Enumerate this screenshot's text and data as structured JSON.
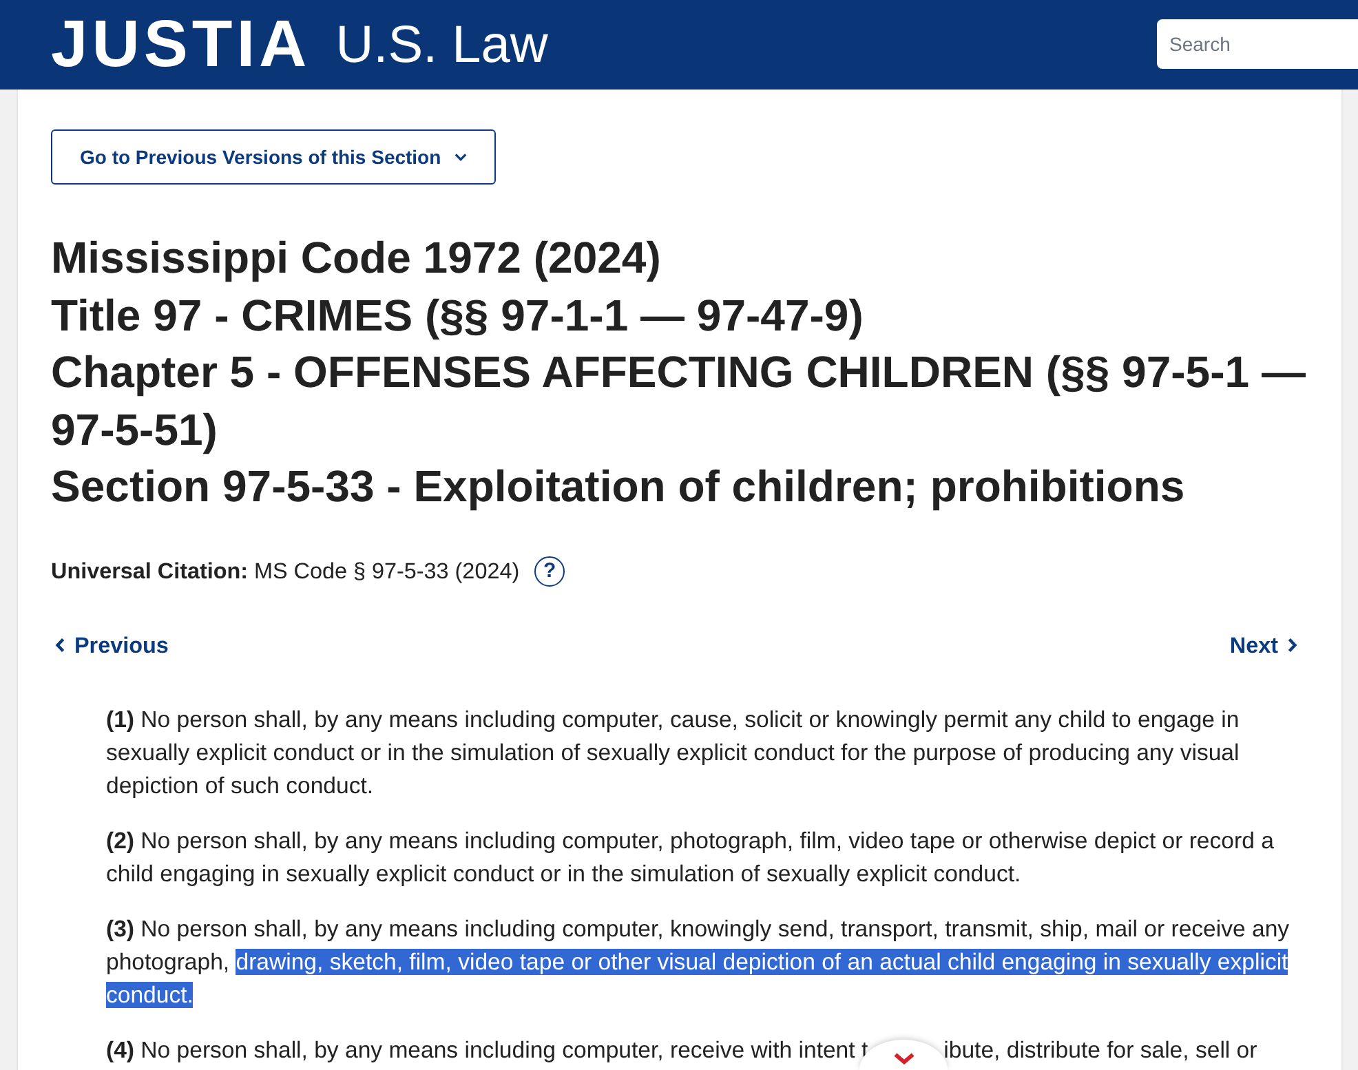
{
  "header": {
    "logo": "JUSTIA",
    "section": "U.S. Law",
    "search": {
      "placeholder": "Search"
    }
  },
  "versions_button": {
    "label": "Go to Previous Versions of this Section"
  },
  "heading": [
    "Mississippi Code 1972 (2024)",
    "Title 97 - CRIMES (§§ 97-1-1 — 97-47-9)",
    "Chapter 5 - OFFENSES AFFECTING CHILDREN (§§ 97-5-1 — 97-5-51)",
    "Section 97-5-33 - Exploitation of children; prohibitions"
  ],
  "citation": {
    "text": "**Universal Citation:** MS Code § 97-5-33 (2024)",
    "help_icon": "?"
  },
  "pager": {
    "previous": "Previous",
    "next": "Next"
  },
  "paragraphs": [
    {
      "obscured": false,
      "segments": [
        {
          "text": "**(1)** No person shall, by any means including computer, cause, solicit or knowingly permit any child to engage in sexually explicit conduct or in the simulation of sexually explicit conduct for the purpose of producing any visual depiction of such conduct.",
          "selected": false
        }
      ]
    },
    {
      "obscured": false,
      "segments": [
        {
          "text": "**(2)** No person shall, by any means including computer, photograph, film, video tape or otherwise depict or record a child engaging in sexually explicit conduct or in the simulation of sexually explicit conduct.",
          "selected": false
        }
      ]
    },
    {
      "obscured": false,
      "segments": [
        {
          "text": "**(3)** No person shall, by any means including computer, knowingly send, transport, transmit, ship, mail or receive any photograph, ",
          "selected": false
        },
        {
          "text": "drawing, sketch, film, video tape or other visual depiction of an actual child engaging in sexually explicit conduct.",
          "selected": true
        }
      ]
    },
    {
      "obscured": true,
      "segments": [
        {
          "text": "**(4)** No person shall, by any means including computer, receive with intent t",
          "selected": false
        },
        {
          "text": "ibute, distribute for sale, sell or",
          "selected": false
        }
      ]
    }
  ]
}
